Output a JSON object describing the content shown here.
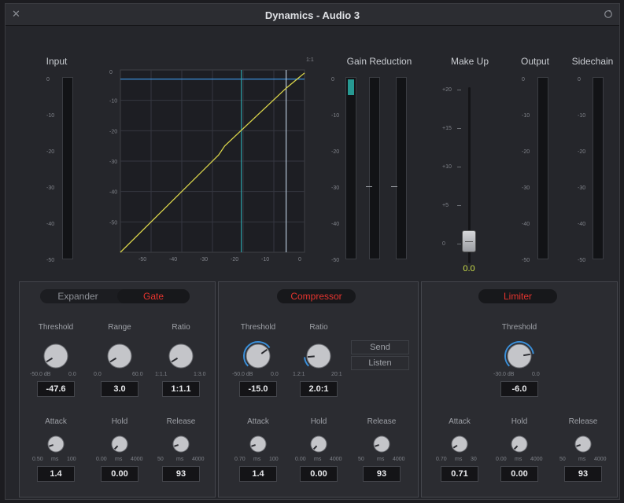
{
  "window": {
    "title": "Dynamics - Audio 3"
  },
  "icons": {
    "close": "close-icon",
    "reset": "reset-icon"
  },
  "meters": {
    "input_label": "Input",
    "input_ticks": [
      "0",
      "-10",
      "-20",
      "-30",
      "-40",
      "-50"
    ],
    "gain_reduction_label": "Gain Reduction",
    "gr_ticks": [
      "0",
      "-10",
      "-20",
      "-30",
      "-40",
      "-50"
    ],
    "makeup_label": "Make Up",
    "makeup_ticks": [
      "+20",
      "+15",
      "+10",
      "+5",
      "0"
    ],
    "makeup_value": "0.0",
    "makeup_level": 0,
    "output_label": "Output",
    "output_ticks": [
      "0",
      "-10",
      "-20",
      "-30",
      "-40",
      "-50"
    ],
    "sidechain_label": "Sidechain",
    "sidechain_ticks": [
      "0",
      "-10",
      "-20",
      "-30",
      "-40",
      "-50"
    ]
  },
  "graph": {
    "corner_label": "1:1",
    "y_ticks": [
      "0",
      "-10",
      "-20",
      "-30",
      "-40",
      "-50"
    ],
    "x_ticks": [
      "-50",
      "-40",
      "-30",
      "-20",
      "-10",
      "0"
    ],
    "gate_threshold_db": -47.6,
    "comp_threshold_db": -15,
    "blue_line_db": -3
  },
  "expander_gate": {
    "tab_expander": "Expander",
    "tab_gate": "Gate",
    "threshold": {
      "label": "Threshold",
      "min": "-50.0 dB",
      "max": "0.0",
      "value": "-47.6",
      "level": 0.05
    },
    "range": {
      "label": "Range",
      "min": "0.0",
      "max": "60.0",
      "value": "3.0",
      "level": 0.05
    },
    "ratio": {
      "label": "Ratio",
      "min": "1:1.1",
      "max": "1:3.0",
      "value": "1:1.1",
      "level": 0.05
    },
    "attack": {
      "label": "Attack",
      "min": "0.50",
      "unit": "ms",
      "max": "100",
      "value": "1.4",
      "level": 0.1
    },
    "hold": {
      "label": "Hold",
      "min": "0.00",
      "unit": "ms",
      "max": "4000",
      "value": "0.00",
      "level": 0
    },
    "release": {
      "label": "Release",
      "min": "50",
      "unit": "ms",
      "max": "4000",
      "value": "93",
      "level": 0.1
    }
  },
  "compressor": {
    "title": "Compressor",
    "threshold": {
      "label": "Threshold",
      "min": "-50.0 dB",
      "max": "0.0",
      "value": "-15.0",
      "level": 0.7
    },
    "ratio": {
      "label": "Ratio",
      "min": "1.2:1",
      "max": "20:1",
      "value": "2.0:1",
      "level": 0.15
    },
    "send": "Send",
    "listen": "Listen",
    "attack": {
      "label": "Attack",
      "min": "0.70",
      "unit": "ms",
      "max": "100",
      "value": "1.4",
      "level": 0.1
    },
    "hold": {
      "label": "Hold",
      "min": "0.00",
      "unit": "ms",
      "max": "4000",
      "value": "0.00",
      "level": 0
    },
    "release": {
      "label": "Release",
      "min": "50",
      "unit": "ms",
      "max": "4000",
      "value": "93",
      "level": 0.1
    }
  },
  "limiter": {
    "title": "Limiter",
    "threshold": {
      "label": "Threshold",
      "min": "-30.0 dB",
      "max": "0.0",
      "value": "-6.0",
      "level": 0.8
    },
    "attack": {
      "label": "Attack",
      "min": "0.70",
      "unit": "ms",
      "max": "30",
      "value": "0.71",
      "level": 0.05
    },
    "hold": {
      "label": "Hold",
      "min": "0.00",
      "unit": "ms",
      "max": "4000",
      "value": "0.00",
      "level": 0
    },
    "release": {
      "label": "Release",
      "min": "50",
      "unit": "ms",
      "max": "4000",
      "value": "93",
      "level": 0.1
    }
  }
}
